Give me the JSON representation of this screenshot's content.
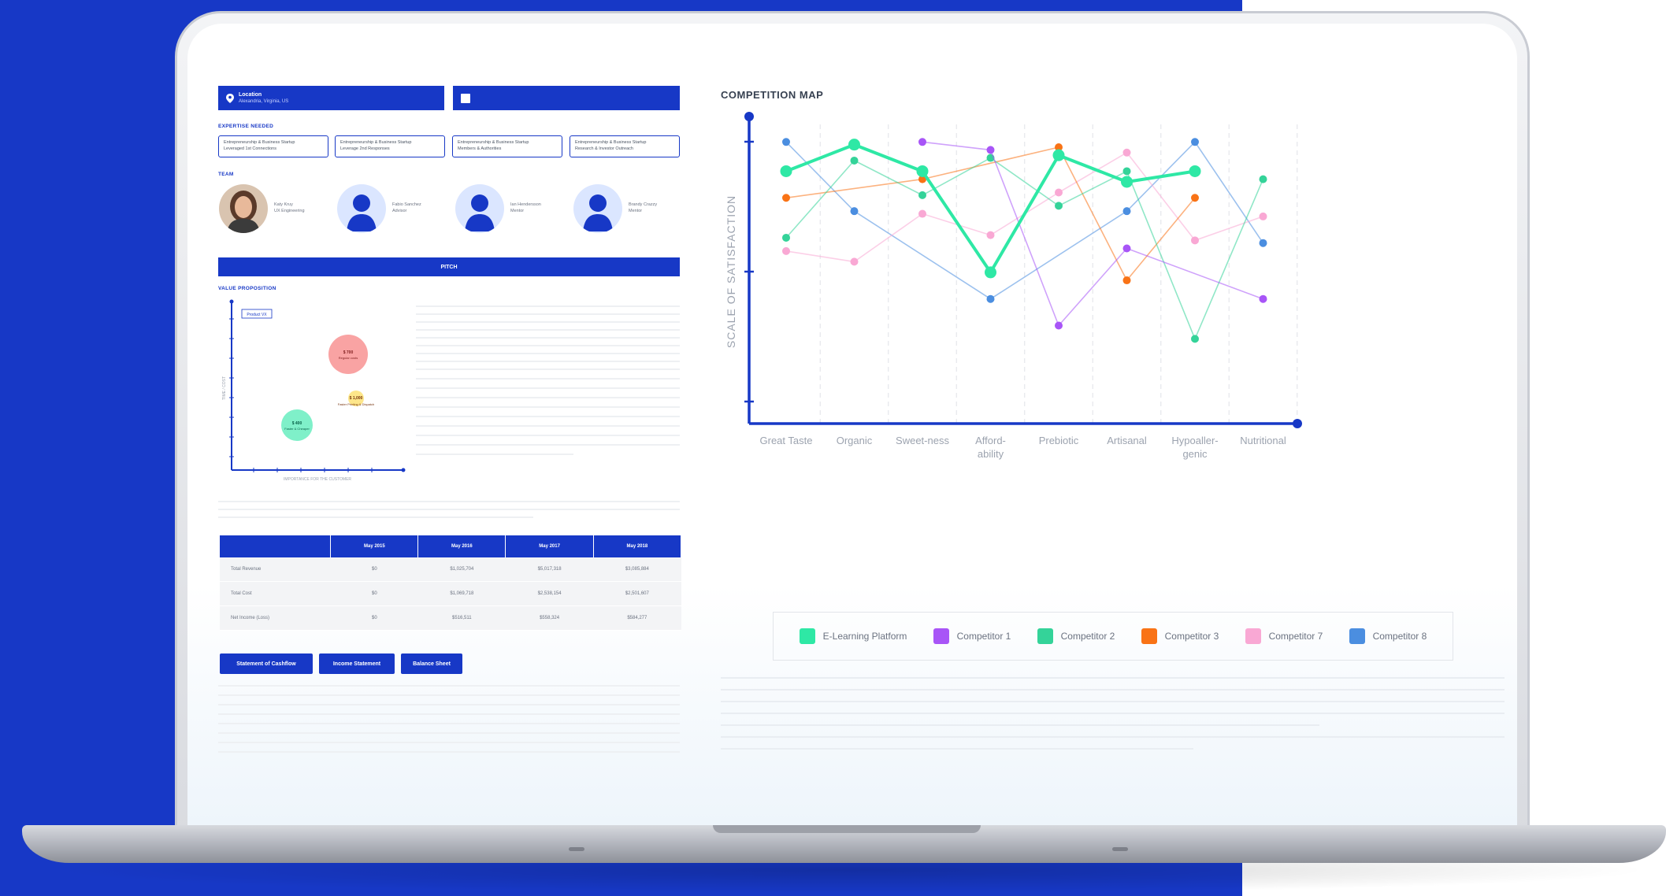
{
  "left_panel": {
    "location_label": "Location",
    "location_value": "Alexandria, Virginia, US",
    "expertise_label": "EXPERTISE NEEDED",
    "expertise": [
      {
        "line1": "Entrepreneurship & Business Startup",
        "line2": "Leveraged 1st Connections"
      },
      {
        "line1": "Entrepreneurship & Business Startup",
        "line2": "Leverage 2nd Responses"
      },
      {
        "line1": "Entrepreneurship & Business Startup",
        "line2": "Members & Authorities"
      },
      {
        "line1": "Entrepreneurship & Business Startup",
        "line2": "Research & Investor Outreach"
      }
    ],
    "team_label": "TEAM",
    "team": [
      {
        "name": "Katy Kruy",
        "role": "UX Engineering"
      },
      {
        "name": "Fabio Sanchez",
        "role": "Advisor"
      },
      {
        "name": "Ian Hendersson",
        "role": "Mentor"
      },
      {
        "name": "Brandy Crazzy",
        "role": "Mentor"
      }
    ],
    "pitch_label": "PITCH",
    "value_prop_label": "VALUE PROPOSITION",
    "bubble_chart": {
      "legend": "Product VX",
      "y_label": "TIME / COST",
      "x_label": "IMPORTANCE FOR THE CUSTOMER",
      "bubbles": [
        {
          "value": "$ 700",
          "label": "Regular costs",
          "color": "#f9a3a3"
        },
        {
          "value": "$ 1,000",
          "label": "Faster Printing & Dispatch",
          "color": "#fde68a"
        },
        {
          "value": "$ 400",
          "label": "Faster & Cheaper",
          "color": "#7ff0c9"
        }
      ]
    },
    "financials": {
      "columns": [
        "",
        "May 2015",
        "May 2016",
        "May 2017",
        "May 2018"
      ],
      "rows": [
        {
          "label": "Total Revenue",
          "values": [
            "$0",
            "$1,025,704",
            "$5,017,318",
            "$3,085,884"
          ]
        },
        {
          "label": "Total Cost",
          "values": [
            "$0",
            "$1,069,718",
            "$2,538,154",
            "$2,501,607"
          ]
        },
        {
          "label": "Net Income (Loss)",
          "values": [
            "$0",
            "$516,511",
            "$558,324",
            "$584,277"
          ]
        }
      ]
    },
    "buttons": {
      "cashflow": "Statement of Cashflow",
      "income": "Income Statement",
      "balance": "Balance Sheet"
    }
  },
  "competition": {
    "title": "COMPETITION MAP",
    "colors": {
      "elearning": "#2ee8a5",
      "c1": "#a855f7",
      "c2": "#34d399",
      "c3": "#f97316",
      "c7": "#f9a8d4",
      "c8": "#4b8ee0",
      "axis": "#1738c6"
    }
  },
  "chart_data": {
    "type": "line",
    "ylabel": "SCALE OF SATISFACTION",
    "categories": [
      "Great Taste",
      "Organic",
      "Sweet-ness",
      "Afford-ability",
      "Prebiotic",
      "Artisanal",
      "Hypoaller-genic",
      "Nutritional"
    ],
    "ylim": [
      0,
      10
    ],
    "series": [
      {
        "name": "E-Learning Platform",
        "values": [
          8.3,
          9.3,
          8.3,
          4.5,
          8.9,
          7.9,
          8.3,
          null
        ]
      },
      {
        "name": "Competitor 1",
        "values": [
          null,
          null,
          9.4,
          9.1,
          2.5,
          5.4,
          null,
          3.5
        ]
      },
      {
        "name": "Competitor 2",
        "values": [
          5.8,
          8.7,
          7.4,
          8.8,
          7.0,
          8.3,
          2.0,
          8.0
        ]
      },
      {
        "name": "Competitor 3",
        "values": [
          7.3,
          null,
          8.0,
          null,
          9.2,
          4.2,
          7.3,
          null
        ]
      },
      {
        "name": "Competitor 7",
        "values": [
          5.3,
          4.9,
          6.7,
          5.9,
          7.5,
          9.0,
          5.7,
          6.6
        ]
      },
      {
        "name": "Competitor 8",
        "values": [
          9.4,
          6.8,
          null,
          3.5,
          null,
          6.8,
          9.4,
          5.6
        ]
      }
    ]
  }
}
